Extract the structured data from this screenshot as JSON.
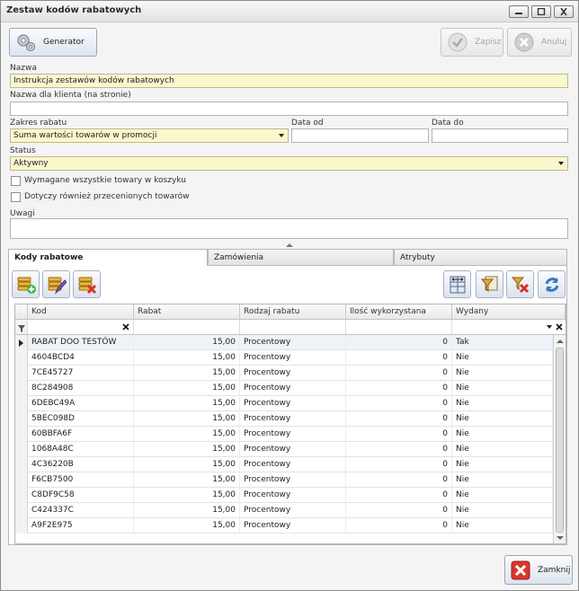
{
  "window": {
    "title": "Zestaw kodów rabatowych"
  },
  "toolbar": {
    "generator_label": "Generator",
    "save_label": "Zapisz",
    "cancel_label": "Anuluj"
  },
  "form": {
    "name_label": "Nazwa",
    "name_value": "Instrukcja zestawów kodów rabatowych",
    "client_name_label": "Nazwa dla klienta (na stronie)",
    "client_name_value": "",
    "scope_label": "Zakres rabatu",
    "scope_value": "Suma wartości towarów w promocji",
    "date_from_label": "Data od",
    "date_from_value": "",
    "date_to_label": "Data do",
    "date_to_value": "",
    "status_label": "Status",
    "status_value": "Aktywny",
    "check_all_items_label": "Wymagane wszystkie towary w koszyku",
    "check_discounted_label": "Dotyczy również przecenionych towarów",
    "notes_label": "Uwagi",
    "notes_value": ""
  },
  "tabs": [
    {
      "label": "Kody rabatowe"
    },
    {
      "label": "Zamówienia"
    },
    {
      "label": "Atrybuty"
    }
  ],
  "grid": {
    "columns": [
      "Kod",
      "Rabat",
      "Rodzaj rabatu",
      "Ilość wykorzystana",
      "Wydany"
    ],
    "rows": [
      [
        "RABAT DOO TESTÓW",
        "15,00",
        "Procentowy",
        "0",
        "Tak"
      ],
      [
        "4604BCD4",
        "15,00",
        "Procentowy",
        "0",
        "Nie"
      ],
      [
        "7CE45727",
        "15,00",
        "Procentowy",
        "0",
        "Nie"
      ],
      [
        "8C284908",
        "15,00",
        "Procentowy",
        "0",
        "Nie"
      ],
      [
        "6DEBC49A",
        "15,00",
        "Procentowy",
        "0",
        "Nie"
      ],
      [
        "5BEC098D",
        "15,00",
        "Procentowy",
        "0",
        "Nie"
      ],
      [
        "60BBFA6F",
        "15,00",
        "Procentowy",
        "0",
        "Nie"
      ],
      [
        "1068A48C",
        "15,00",
        "Procentowy",
        "0",
        "Nie"
      ],
      [
        "4C36220B",
        "15,00",
        "Procentowy",
        "0",
        "Nie"
      ],
      [
        "F6CB7500",
        "15,00",
        "Procentowy",
        "0",
        "Nie"
      ],
      [
        "C8DF9C58",
        "15,00",
        "Procentowy",
        "0",
        "Nie"
      ],
      [
        "C424337C",
        "15,00",
        "Procentowy",
        "0",
        "Nie"
      ],
      [
        "A9F2E975",
        "15,00",
        "Procentowy",
        "0",
        "Nie"
      ]
    ]
  },
  "footer": {
    "close_label": "Zamknij"
  }
}
